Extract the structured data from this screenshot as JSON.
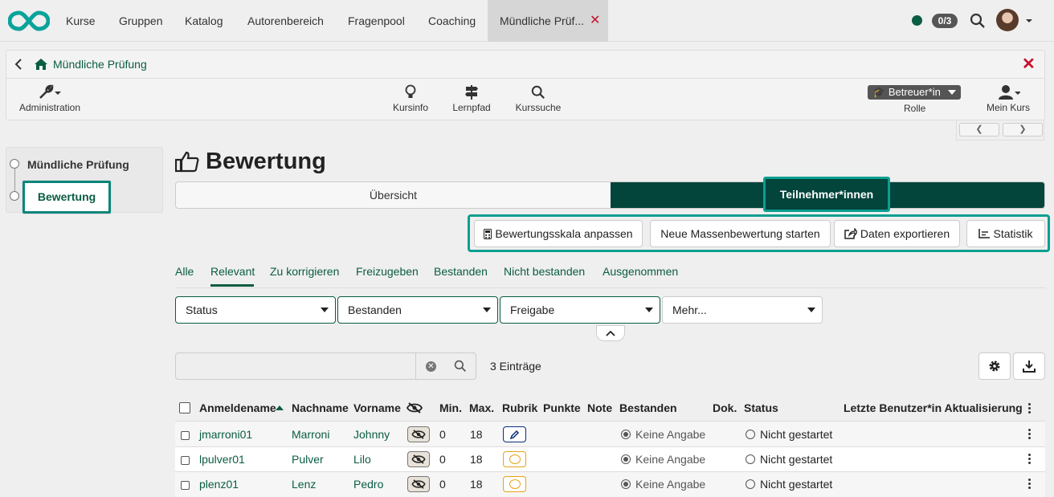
{
  "topnav": {
    "items": [
      "Kurse",
      "Gruppen",
      "Katalog",
      "Autorenbereich",
      "Fragenpool",
      "Coaching"
    ],
    "active_tab": "Mündliche Prüf...",
    "counter": "0/3"
  },
  "course": {
    "title": "Mündliche Prüfung",
    "tools": {
      "administration": "Administration",
      "kursinfo": "Kursinfo",
      "lernpfad": "Lernpfad",
      "kurssuche": "Kurssuche",
      "rolle": "Rolle",
      "mein_kurs": "Mein Kurs"
    },
    "role_badge": "Betreuer*in"
  },
  "leftmenu": {
    "items": [
      "Mündliche Prüfung",
      "Bewertung"
    ]
  },
  "main": {
    "heading": "Bewertung",
    "segments": [
      "Übersicht",
      "Teilnehmer*innen"
    ],
    "actions": [
      "Bewertungsskala anpassen",
      "Neue Massenbewertung starten",
      "Daten exportieren",
      "Statistik"
    ],
    "filter_tabs": [
      "Alle",
      "Relevant",
      "Zu korrigieren",
      "Freizugeben",
      "Bestanden",
      "Nicht bestanden",
      "Ausgenommen"
    ],
    "filters": [
      "Status",
      "Bestanden",
      "Freigabe",
      "Mehr..."
    ],
    "entries": "3 Einträge"
  },
  "table": {
    "columns": [
      "Anmeldename",
      "Nachname",
      "Vorname",
      "Min.",
      "Max.",
      "Rubrik",
      "Punkte",
      "Note",
      "Bestanden",
      "Dok.",
      "Status",
      "Letzte Benutzer*in Aktualisierung"
    ],
    "rows": [
      {
        "login": "jmarroni01",
        "last": "Marroni",
        "first": "Johnny",
        "min": "0",
        "max": "18",
        "passed": "Keine Angabe",
        "status": "Nicht gestartet"
      },
      {
        "login": "lpulver01",
        "last": "Pulver",
        "first": "Lilo",
        "min": "0",
        "max": "18",
        "passed": "Keine Angabe",
        "status": "Nicht gestartet"
      },
      {
        "login": "plenz01",
        "last": "Lenz",
        "first": "Pedro",
        "min": "0",
        "max": "18",
        "passed": "Keine Angabe",
        "status": "Nicht gestartet"
      }
    ]
  },
  "colors": {
    "brand_dark": "#03443b",
    "brand_text": "#0a5c43",
    "highlight": "#0a9f90",
    "close_red": "#c8102e"
  }
}
